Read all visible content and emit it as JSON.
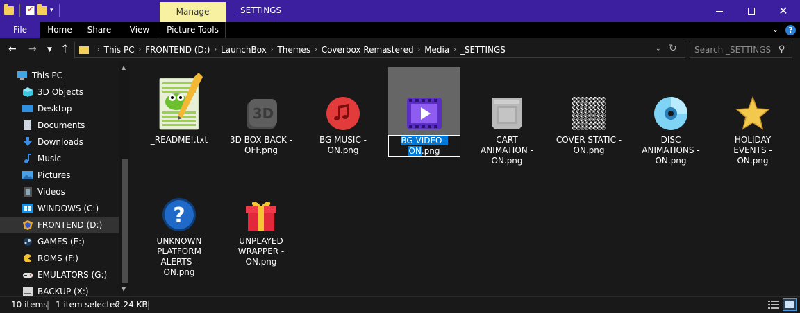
{
  "window": {
    "title": "_SETTINGS",
    "manage_label": "Manage",
    "accent": "#3b1f9e",
    "manage_color": "#f7f1a1"
  },
  "ribbon": {
    "file": "File",
    "tabs": [
      "Home",
      "Share",
      "View",
      "Picture Tools"
    ]
  },
  "address": {
    "crumbs": [
      "This PC",
      "FRONTEND (D:)",
      "LaunchBox",
      "Themes",
      "Coverbox Remastered",
      "Media",
      "_SETTINGS"
    ]
  },
  "search": {
    "placeholder": "Search _SETTINGS"
  },
  "sidebar": {
    "items": [
      {
        "label": "This PC",
        "icon": "computer-icon"
      },
      {
        "label": "3D Objects",
        "icon": "cube-icon"
      },
      {
        "label": "Desktop",
        "icon": "desktop-icon"
      },
      {
        "label": "Documents",
        "icon": "document-icon"
      },
      {
        "label": "Downloads",
        "icon": "download-icon"
      },
      {
        "label": "Music",
        "icon": "music-note-icon"
      },
      {
        "label": "Pictures",
        "icon": "picture-icon"
      },
      {
        "label": "Videos",
        "icon": "film-icon"
      },
      {
        "label": "WINDOWS (C:)",
        "icon": "windows-drive-icon"
      },
      {
        "label": "FRONTEND (D:)",
        "icon": "launchbox-drive-icon",
        "selected": true
      },
      {
        "label": "GAMES (E:)",
        "icon": "steam-drive-icon"
      },
      {
        "label": "ROMS (F:)",
        "icon": "pacman-drive-icon"
      },
      {
        "label": "EMULATORS (G:)",
        "icon": "gamepad-drive-icon"
      },
      {
        "label": "BACKUP (X:)",
        "icon": "backup-drive-icon"
      }
    ]
  },
  "files": [
    {
      "name": "_README!.txt",
      "icon": "notepad-plus-plus-icon"
    },
    {
      "name": "3D BOX BACK - OFF.png",
      "icon": "3d-box-icon"
    },
    {
      "name": "BG MUSIC - ON.png",
      "icon": "music-circle-icon"
    },
    {
      "name_sel": "BG VIDEO - ON",
      "name_ext": ".png",
      "icon": "video-player-icon",
      "selected": true
    },
    {
      "name": "CART ANIMATION - ON.png",
      "icon": "cartridge-icon"
    },
    {
      "name": "COVER STATIC - ON.png",
      "icon": "tv-static-icon"
    },
    {
      "name": "DISC ANIMATIONS - ON.png",
      "icon": "disc-icon"
    },
    {
      "name": "HOLIDAY EVENTS - ON.png",
      "icon": "star-icon"
    },
    {
      "name": "UNKNOWN PLATFORM ALERTS - ON.png",
      "icon": "question-mark-icon"
    },
    {
      "name": "UNPLAYED WRAPPER - ON.png",
      "icon": "gift-icon"
    }
  ],
  "status": {
    "count": "10 items",
    "selected": "1 item selected",
    "size": "2.24 KB"
  }
}
